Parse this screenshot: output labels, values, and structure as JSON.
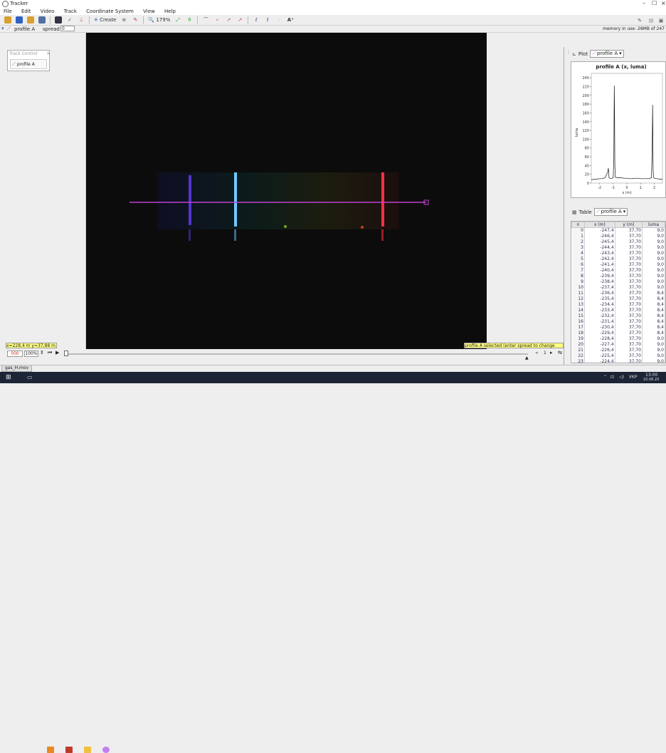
{
  "window": {
    "title": "Tracker",
    "min": "–",
    "max": "☐",
    "close": "×"
  },
  "menu": [
    "File",
    "Edit",
    "Video",
    "Track",
    "Coordinate System",
    "View",
    "Help"
  ],
  "toolbar": {
    "create_label": "Create",
    "zoom_label": "179%"
  },
  "trackbar": {
    "track_name": "profile A",
    "spread_label": "spread",
    "spread_value": "0",
    "memory": "memory in use: 28MB of 247"
  },
  "track_control": {
    "title": "Track Control",
    "item": "profile A"
  },
  "status": {
    "coords": "x=228,4 m  y=37,88 m",
    "hint": "profile A selected (enter spread to change line width)"
  },
  "player": {
    "frame": "000",
    "rate": "100%",
    "step": "1"
  },
  "file_tab": "gas_H.mov",
  "plot": {
    "tab_label": "Plot",
    "track_select": "profile A",
    "chart_data": {
      "type": "line",
      "title": "profile A (x, luma)",
      "xlabel": "x (m)",
      "ylabel": "luma",
      "xlim": [
        -2.6,
        2.6
      ],
      "ylim": [
        0,
        250
      ],
      "xticks": [
        -2,
        -1,
        0,
        1,
        2
      ],
      "yticks": [
        0,
        20,
        40,
        60,
        80,
        100,
        120,
        140,
        160,
        180,
        200,
        220,
        240
      ],
      "grid": false,
      "series": [
        {
          "x": [
            -2.6,
            -2.2,
            -2.0,
            -1.8,
            -1.6,
            -1.4,
            -1.35,
            -1.3,
            -1.2,
            -1.0,
            -0.95,
            -0.92,
            -0.9,
            -0.88,
            -0.85,
            -0.8,
            -0.6,
            -0.4,
            -0.2,
            0.0,
            0.2,
            0.4,
            0.6,
            0.8,
            1.0,
            1.2,
            1.4,
            1.6,
            1.8,
            1.85,
            1.88,
            1.9,
            1.92,
            1.95,
            2.0,
            2.2,
            2.4,
            2.6
          ],
          "y": [
            8,
            9,
            10,
            10,
            12,
            25,
            34,
            12,
            10,
            12,
            60,
            222,
            160,
            40,
            14,
            13,
            12,
            12,
            11,
            11,
            10,
            10,
            11,
            11,
            10,
            10,
            10,
            10,
            12,
            80,
            178,
            120,
            30,
            14,
            11,
            10,
            9,
            9
          ]
        }
      ]
    }
  },
  "table": {
    "tab_label": "Table",
    "track_select": "profile A",
    "columns": [
      "n",
      "x (m)",
      "y (m)",
      "luma"
    ],
    "rows": [
      [
        "0",
        "-247,4",
        "37,70",
        "9,0"
      ],
      [
        "1",
        "-246,4",
        "37,70",
        "9,0"
      ],
      [
        "2",
        "-245,4",
        "37,70",
        "9,0"
      ],
      [
        "3",
        "-244,4",
        "37,70",
        "9,0"
      ],
      [
        "4",
        "-243,4",
        "37,70",
        "9,0"
      ],
      [
        "5",
        "-242,4",
        "37,70",
        "9,0"
      ],
      [
        "6",
        "-241,4",
        "37,70",
        "9,0"
      ],
      [
        "7",
        "-240,4",
        "37,70",
        "9,0"
      ],
      [
        "8",
        "-239,4",
        "37,70",
        "9,0"
      ],
      [
        "9",
        "-238,4",
        "37,70",
        "9,0"
      ],
      [
        "10",
        "-237,4",
        "37,70",
        "9,0"
      ],
      [
        "11",
        "-236,4",
        "37,70",
        "8,4"
      ],
      [
        "12",
        "-235,4",
        "37,70",
        "8,4"
      ],
      [
        "13",
        "-234,4",
        "37,70",
        "8,4"
      ],
      [
        "14",
        "-233,4",
        "37,70",
        "8,4"
      ],
      [
        "15",
        "-232,4",
        "37,70",
        "8,4"
      ],
      [
        "16",
        "-231,4",
        "37,70",
        "8,4"
      ],
      [
        "17",
        "-230,4",
        "37,70",
        "8,4"
      ],
      [
        "18",
        "-229,4",
        "37,70",
        "8,4"
      ],
      [
        "19",
        "-228,4",
        "37,70",
        "9,0"
      ],
      [
        "20",
        "-227,4",
        "37,70",
        "9,0"
      ],
      [
        "21",
        "-226,4",
        "37,70",
        "9,0"
      ],
      [
        "22",
        "-225,4",
        "37,70",
        "9,0"
      ],
      [
        "23",
        "-224,4",
        "37,70",
        "9,0"
      ]
    ]
  },
  "taskbar": {
    "lang": "УКР",
    "time": "13:00",
    "date": "10.06.20"
  },
  "colors": {
    "profile_line": "#c040d0",
    "status_bg": "#ffff80",
    "video_bg": "#0c0c0c"
  }
}
